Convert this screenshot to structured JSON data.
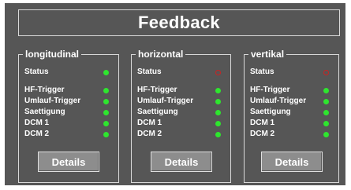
{
  "title": "Feedback",
  "groups": [
    {
      "legend": "longitudinal",
      "status_label": "Status",
      "status_led": "green",
      "rows": [
        {
          "label": "HF-Trigger",
          "led": "green"
        },
        {
          "label": "Umlauf-Trigger",
          "led": "green"
        },
        {
          "label": "Saettigung",
          "led": "green"
        },
        {
          "label": "DCM 1",
          "led": "green"
        },
        {
          "label": "DCM 2",
          "led": "green"
        }
      ],
      "button": "Details"
    },
    {
      "legend": "horizontal",
      "status_label": "Status",
      "status_led": "off",
      "rows": [
        {
          "label": "HF-Trigger",
          "led": "green"
        },
        {
          "label": "Umlauf-Trigger",
          "led": "green"
        },
        {
          "label": "Saettigung",
          "led": "green"
        },
        {
          "label": "DCM 1",
          "led": "green"
        },
        {
          "label": "DCM 2",
          "led": "green"
        }
      ],
      "button": "Details"
    },
    {
      "legend": "vertikal",
      "status_label": "Status",
      "status_led": "off",
      "rows": [
        {
          "label": "HF-Trigger",
          "led": "green"
        },
        {
          "label": "Umlauf-Trigger",
          "led": "green"
        },
        {
          "label": "Saettigung",
          "led": "green"
        },
        {
          "label": "DCM 1",
          "led": "green"
        },
        {
          "label": "DCM 2",
          "led": "green"
        }
      ],
      "button": "Details"
    }
  ],
  "colors": {
    "panel": "#565656",
    "led_on": "#2ee62e",
    "led_off": "#cc2222",
    "button": "#8d8d8d"
  }
}
